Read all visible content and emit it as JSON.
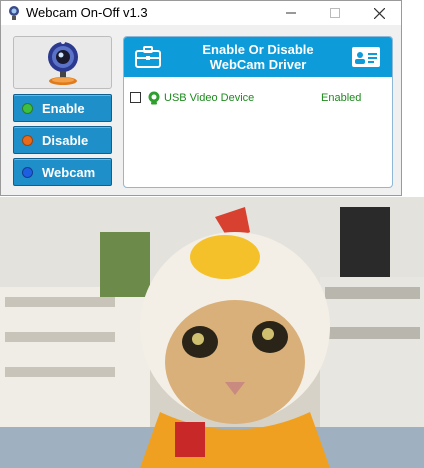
{
  "window": {
    "title": "Webcam On-Off v1.3",
    "controls": {
      "minimize": "—",
      "maximize": "☐",
      "close": "✕"
    }
  },
  "sidebar": {
    "logo_icon": "webcam-logo-icon",
    "buttons": [
      {
        "label": "Enable",
        "dot_color": "#3fbf3f"
      },
      {
        "label": "Disable",
        "dot_color": "#e86a1a"
      },
      {
        "label": "Webcam",
        "dot_color": "#1d5fe0"
      }
    ]
  },
  "panel": {
    "title_line1": "Enable Or Disable",
    "title_line2": "WebCam Driver",
    "header_color": "#0e9bd9",
    "left_icon": "briefcase-icon",
    "right_icon": "id-card-icon",
    "devices": [
      {
        "name": "USB Video Device",
        "status": "Enabled",
        "checked": false
      }
    ]
  },
  "video": {
    "content": "webcam-preview-image"
  }
}
